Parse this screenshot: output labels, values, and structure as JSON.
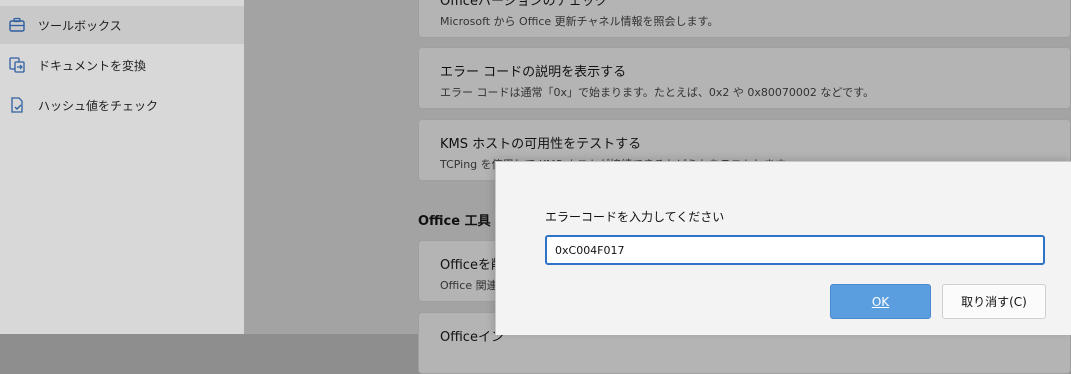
{
  "sidebar": {
    "items": [
      {
        "label": "ツールボックス",
        "icon": "toolbox-icon"
      },
      {
        "label": "ドキュメントを変換",
        "icon": "convert-document-icon"
      },
      {
        "label": "ハッシュ値をチェック",
        "icon": "hash-check-icon"
      }
    ]
  },
  "main": {
    "cards": [
      {
        "title": "Officeバージョンのチェック",
        "desc": "Microsoft から Office 更新チャネル情報を照会します。"
      },
      {
        "title": "エラー コードの説明を表示する",
        "desc": "エラー コードは通常「0x」で始まります。たとえば、0x2 や 0x80070002 などです。"
      },
      {
        "title": "KMS ホストの可用性をテストする",
        "desc": "TCPing を使用して KMS ホストが接続できるかどうかをテストします。"
      }
    ],
    "section_title": "Office 工具",
    "office_cards": [
      {
        "title": "Officeを削",
        "desc": "Office 関連"
      },
      {
        "title": "Officeイン",
        "desc": ""
      }
    ]
  },
  "dialog": {
    "prompt": "エラーコードを入力してください",
    "input_value": "0xC004F017",
    "ok_label": "OK",
    "cancel_label": "取り消す(C)"
  },
  "colors": {
    "accent": "#5b9ee0",
    "input_border": "#2f73c7"
  }
}
